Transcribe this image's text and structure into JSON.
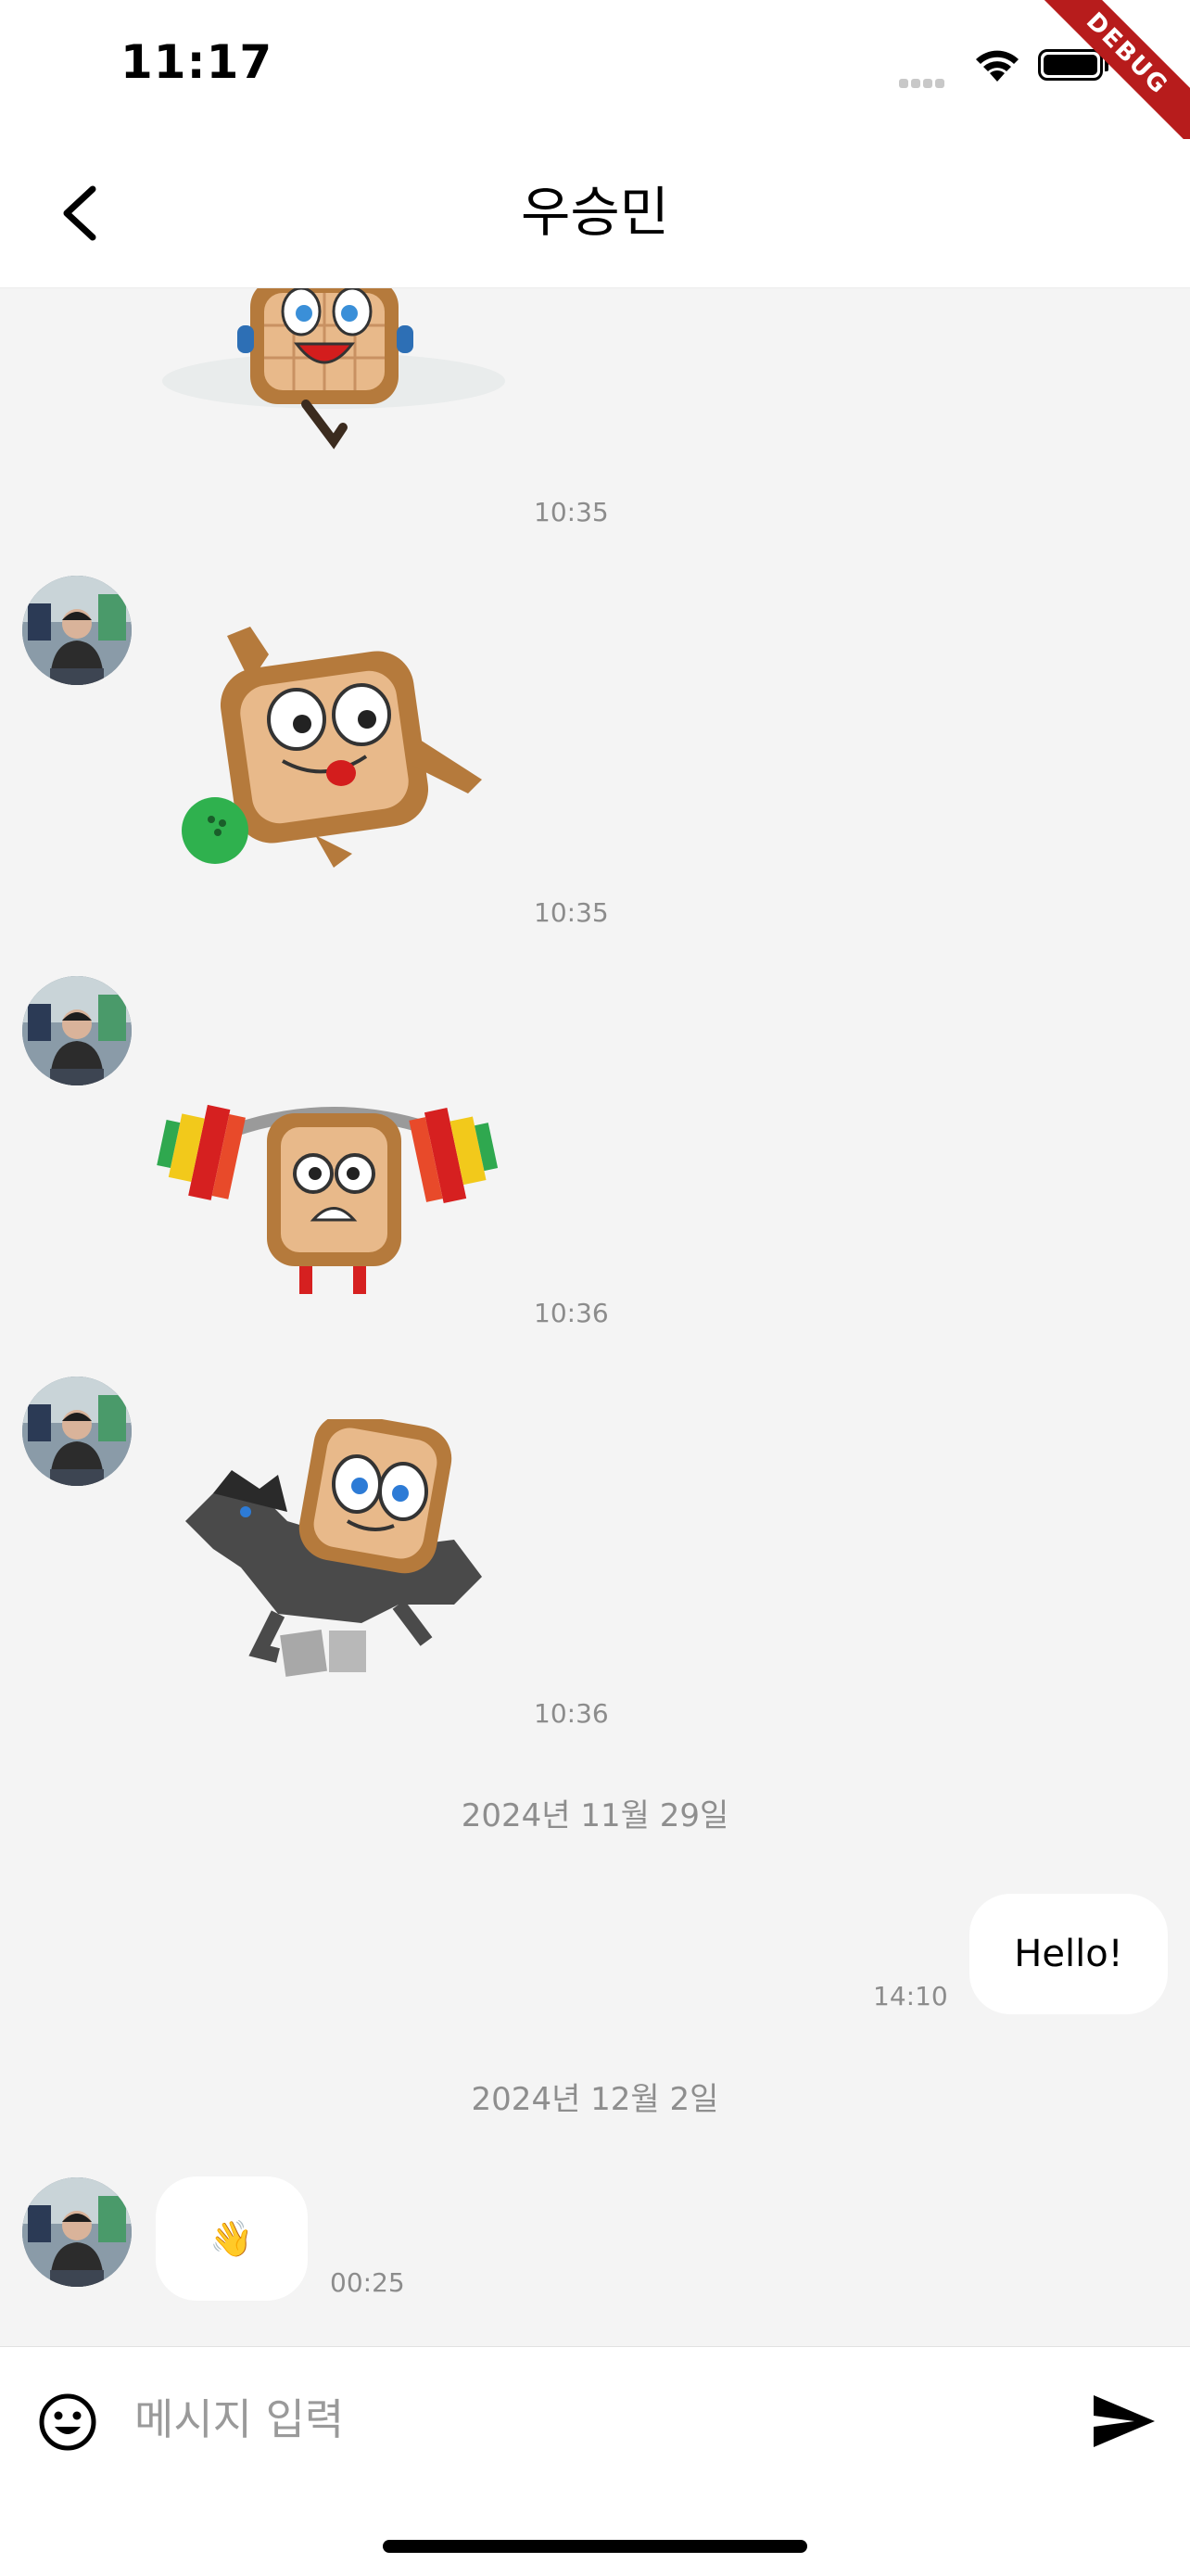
{
  "status_bar": {
    "time": "11:17",
    "debug_banner": "DEBUG"
  },
  "header": {
    "title": "우승민"
  },
  "messages": {
    "t1": "10:35",
    "t2": "10:35",
    "t3": "10:36",
    "t4": "10:36",
    "date1": "2024년 11월 29일",
    "sent_text": "Hello!",
    "sent_time": "14:10",
    "date2": "2024년 12월 2일",
    "recv_emoji": "👋",
    "recv_time": "00:25"
  },
  "composer": {
    "placeholder": "메시지 입력"
  },
  "colors": {
    "background": "#f4f4f4",
    "bubble": "#ffffff",
    "debug": "#b71c1c"
  },
  "icons": [
    "back-arrow-icon",
    "wifi-icon",
    "battery-icon",
    "emoji-icon",
    "send-icon"
  ]
}
